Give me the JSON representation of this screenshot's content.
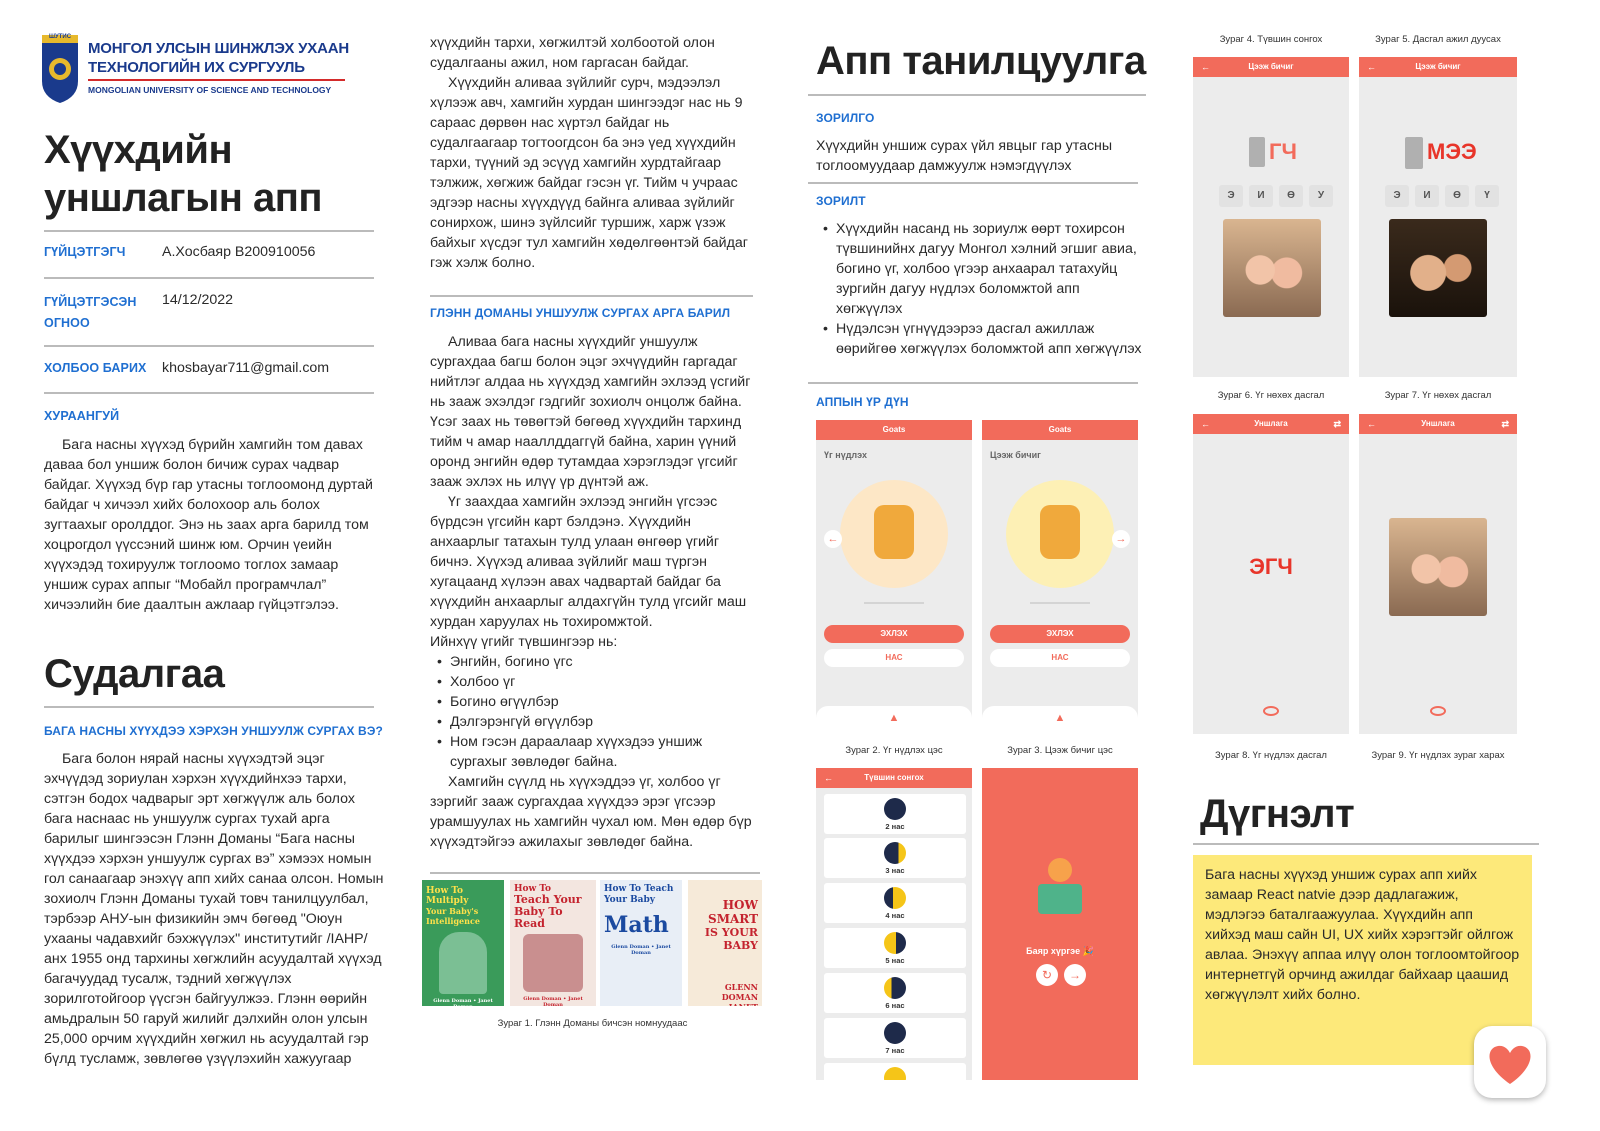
{
  "header": {
    "logo_text": "ШУТИС",
    "univ_mn_line1": "МОНГОЛ УЛСЫН ШИНЖЛЭХ УХААН",
    "univ_mn_line2": "ТЕХНОЛОГИЙН ИХ СУРГУУЛЬ",
    "univ_en": "MONGOLIAN UNIVERSITY OF SCIENCE AND TECHNOLOGY"
  },
  "title": {
    "line1": "Хүүхдийн",
    "line2": "уншлагын апп"
  },
  "meta": [
    {
      "label": "ГҮЙЦЭТГЭГЧ",
      "value": "А.Хосбаяр B200910056"
    },
    {
      "label": "ГҮЙЦЭТГЭСЭН ОГНОО",
      "value": "14/12/2022"
    },
    {
      "label": "ХОЛБОО БАРИХ",
      "value": "khosbayar711@gmail.com"
    }
  ],
  "abstract": {
    "heading": "ХУРААНГУЙ",
    "text": "Бага насны хүүхэд бүрийн хамгийн том давах даваа бол уншиж болон бичиж сурах чадвар байдаг. Хүүхэд бүр гар утасны тоглоомонд дуртай байдаг ч хичээл хийх болохоор аль болох зугтаахыг оролддог. Энэ нь заах арга барилд том хоцрогдол үүссэний шинж юм. Орчин үеийн хүүхэдэд тохируулж тоглоомо тоглох замаар уншиж сурах аппыг “Мобайл програмчлал” хичээлийн бие даалтын ажлаар гүйцэтгэлээ."
  },
  "research": {
    "heading": "Судалгаа",
    "sub1": "БАГА НАСНЫ ХҮҮХДЭЭ ХЭРХЭН УНШУУЛЖ СУРГАХ ВЭ?",
    "p1": "Бага болон нярай насны хүүхэдтэй эцэг эхчүүдэд зориулан хэрхэн хүүхдийнхээ тархи, сэтгэн бодох чадварыг эрт хөгжүүлж аль болох бага наснаас нь уншуулж сургах тухай арга барилыг шингээсэн Глэнн Доманы “Бага насны хүүхдээ хэрхэн уншуулж сургах вэ” хэмээх номын гол санаагаар энэхүү апп хийх санаа олсон. Номын зохиолч Глэнн Доманы тухай товч танилцуулбал, тэрбээр АНУ-ын физикийн эмч бөгөөд \"Оюун ухааны чадавхийг бэхжүүлэх\" институтийг /IAHP/ анх 1955 онд тархины хөгжлийн асуудалтай хүүхэд багачуудад тусалж, тэдний хөгжүүлэх зорилготойгоор үүсгэн байгуулжээ. Глэнн өөрийн амьдралын 50 гаруй жилийг дэлхийн олон улсын 25,000 орчим хүүхдийн хөгжил нь асуудалтай гэр бүлд тусламж, зөвлөгөө үзүүлэхийн хажуугаар",
    "p2": "хүүхдийн тархи, хөгжилтэй холбоотой олон судалгааны ажил, ном гаргасан байдаг.",
    "p3": "Хүүхдийн аливаа зүйлийг сурч, мэдээлэл хүлээж авч, хамгийн хурдан шингээдэг нас нь 9 сараас дөрвөн нас хүртэл байдаг нь судалгаагаар тогтоогдсон ба энэ үед хүүхдийн тархи, түүний эд эсүүд хамгийн хурдтайгаар тэлжиж, хөгжиж байдаг гэсэн үг. Тийм ч учраас эдгээр насны хүүхдүүд байнга аливаа зүйлийг сонирхож, шинэ зүйлсийг туршиж, харж үзэж байхыг хүсдэг тул хамгийн хөдөлгөөнтэй байдаг гэж хэлж болно.",
    "sub2": "ГЛЭНН ДОМАНЫ УНШУУЛЖ СУРГАХ АРГА БАРИЛ",
    "p4": "Аливаа бага насны хүүхдийг уншуулж сургахдаа багш болон эцэг эхчүүдийн гаргадаг нийтлэг алдаа нь хүүхдэд хамгийн эхлээд үсгийг нь зааж эхэлдэг гэдгийг зохиолч онцолж байна. Үсэг заах нь төвөгтэй бөгөөд хүүхдийн тархинд тийм ч амар нааллддаггүй байна, харин үүний оронд энгийн өдөр тутамдаа хэрэглэдэг үгсийг зааж эхлэх нь илүү үр дүнтэй аж.",
    "p5": "Үг заахдаа хамгийн эхлээд энгийн үгсээс бүрдсэн үгсийн карт бэлдэнэ. Хүүхдийн анхаарлыг татахын тулд улаан өнгөөр үгийг бичнэ. Хүүхэд аливаа зүйлийг маш түргэн хугацаанд хүлээн авах чадвартай байдаг ба хүүхдийн анхаарлыг алдахгүйн тулд үгсийг маш хурдан харуулах нь тохиромжтой.",
    "p6": "Ийнхүү үгийг түвшингээр нь:",
    "levels": [
      "Энгийн, богино үгс",
      "Холбоо үг",
      "Богино өгүүлбэр",
      "Дэлгэрэнгүй өгүүлбэр",
      "Ном гэсэн дараалаар хүүхэдээ уншиж сургахыг зөвлөдөг байна."
    ],
    "p7": "Хамгийн сүүлд нь хүүхэддээ үг, холбоо үг зэргийг зааж сургахдаа хүүхдээ эрэг үгсээр урамшуулах нь хамгийн чухал юм. Мөн өдөр бүр хүүхэдтэйгээ ажилахыг зөвлөдөг байна.",
    "books": [
      {
        "l1": "How To Multiply",
        "l2": "Your Baby's Intelligence",
        "author": "Glenn Doman • Janet Doman"
      },
      {
        "l1": "How To",
        "l2": "Teach Your Baby To Read",
        "author": "Glenn Doman • Janet Doman"
      },
      {
        "l1": "How To Teach Your Baby",
        "l2": "Math",
        "author": "Glenn Doman • Janet Doman"
      },
      {
        "l1": "HOW SMART",
        "l2": "IS YOUR BABY",
        "author": "GLENN DOMAN JANET DOMAN"
      }
    ],
    "fig1_caption": "Зураг 1. Глэнн Доманы бичсэн номнуудаас"
  },
  "app": {
    "heading": "Апп танилцуулга",
    "goal_label": "ЗОРИЛГО",
    "goal_text": "Хүүхдийн уншиж сурах үйл явцыг гар утасны тоглоомуудаар дамжуулж нэмэгдүүлэх",
    "tasks_label": "ЗОРИЛТ",
    "tasks": [
      "Хүүхдийн насанд нь зориулж өөрт тохирсон түвшинийнх дагуу Монгол хэлний эгшиг авиа, богино үг, холбоо үгээр анхаарал татахуйц зургийн дагуу нүдлэх боломжтой апп хөгжүүлэх",
      "Нүдэлсэн үгнүүдээрээ дасгал ажиллаж өөрийгөө хөгжүүлэх боломжтой апп хөгжүүлэх"
    ],
    "results_label": "АППЫН ҮР ДҮН"
  },
  "screens": {
    "s2": {
      "bar": "Goats",
      "section": "Үг нүдлэх",
      "start": "ЭХЛЭХ",
      "age": "НАС",
      "caption": "Зураг 2. Үг нүдлэх цэс"
    },
    "s3": {
      "bar": "Goats",
      "section": "Цээж бичиг",
      "start": "ЭХЛЭХ",
      "age": "НАС",
      "caption": "Зураг 3. Цээж бичиг цэс"
    },
    "s_level": {
      "bar": "Түвшин сонгох",
      "items": [
        "2 нас",
        "3 нас",
        "4 нас",
        "5 нас",
        "6 нас",
        "7 нас"
      ]
    },
    "s_done": {
      "text": "Баяр хүргэе 🎉"
    },
    "s4": {
      "caption": "Зураг 4. Түвшин сонгох",
      "bar": "Цээж бичиг",
      "word": "ГЧ",
      "vowels": [
        "Э",
        "И",
        "Ө",
        "У"
      ]
    },
    "s5": {
      "caption": "Зураг 5. Дасгал ажил дуусах",
      "bar": "Цээж бичиг",
      "word": "МЭЭ",
      "vowels": [
        "Э",
        "И",
        "Ө",
        "Ү"
      ]
    },
    "s6": {
      "caption": "Зураг 6. Үг нөхөх дасгал"
    },
    "s7": {
      "caption": "Зураг 7. Үг нөхөх дасгал"
    },
    "s8": {
      "bar": "Уншлага",
      "word": "ЭГЧ",
      "caption": "Зураг 8. Үг нүдлэх дасгал"
    },
    "s9": {
      "bar": "Уншлага",
      "caption": "Зураг 9. Үг нүдлэх зураг харах"
    }
  },
  "conclusion": {
    "heading": "Дүгнэлт",
    "text": "Бага насны хүүхэд уншиж сурах апп хийх замаар React natvie дээр дадлагажиж, мэдлэгээ баталгаажуулаа. Хүүхдийн апп хийхэд маш сайн UI, UX хийх хэрэгтэйг ойлгож авлаа. Энэхүү аппаа илүү олон тоглоомтойгоор интернетгүй орчинд ажилдаг байхаар цаашид хөгжүүлэлт хийх болно."
  },
  "colors": {
    "accent": "#f26b5b",
    "link": "#1f6fd1",
    "note_bg": "#fde97a"
  }
}
